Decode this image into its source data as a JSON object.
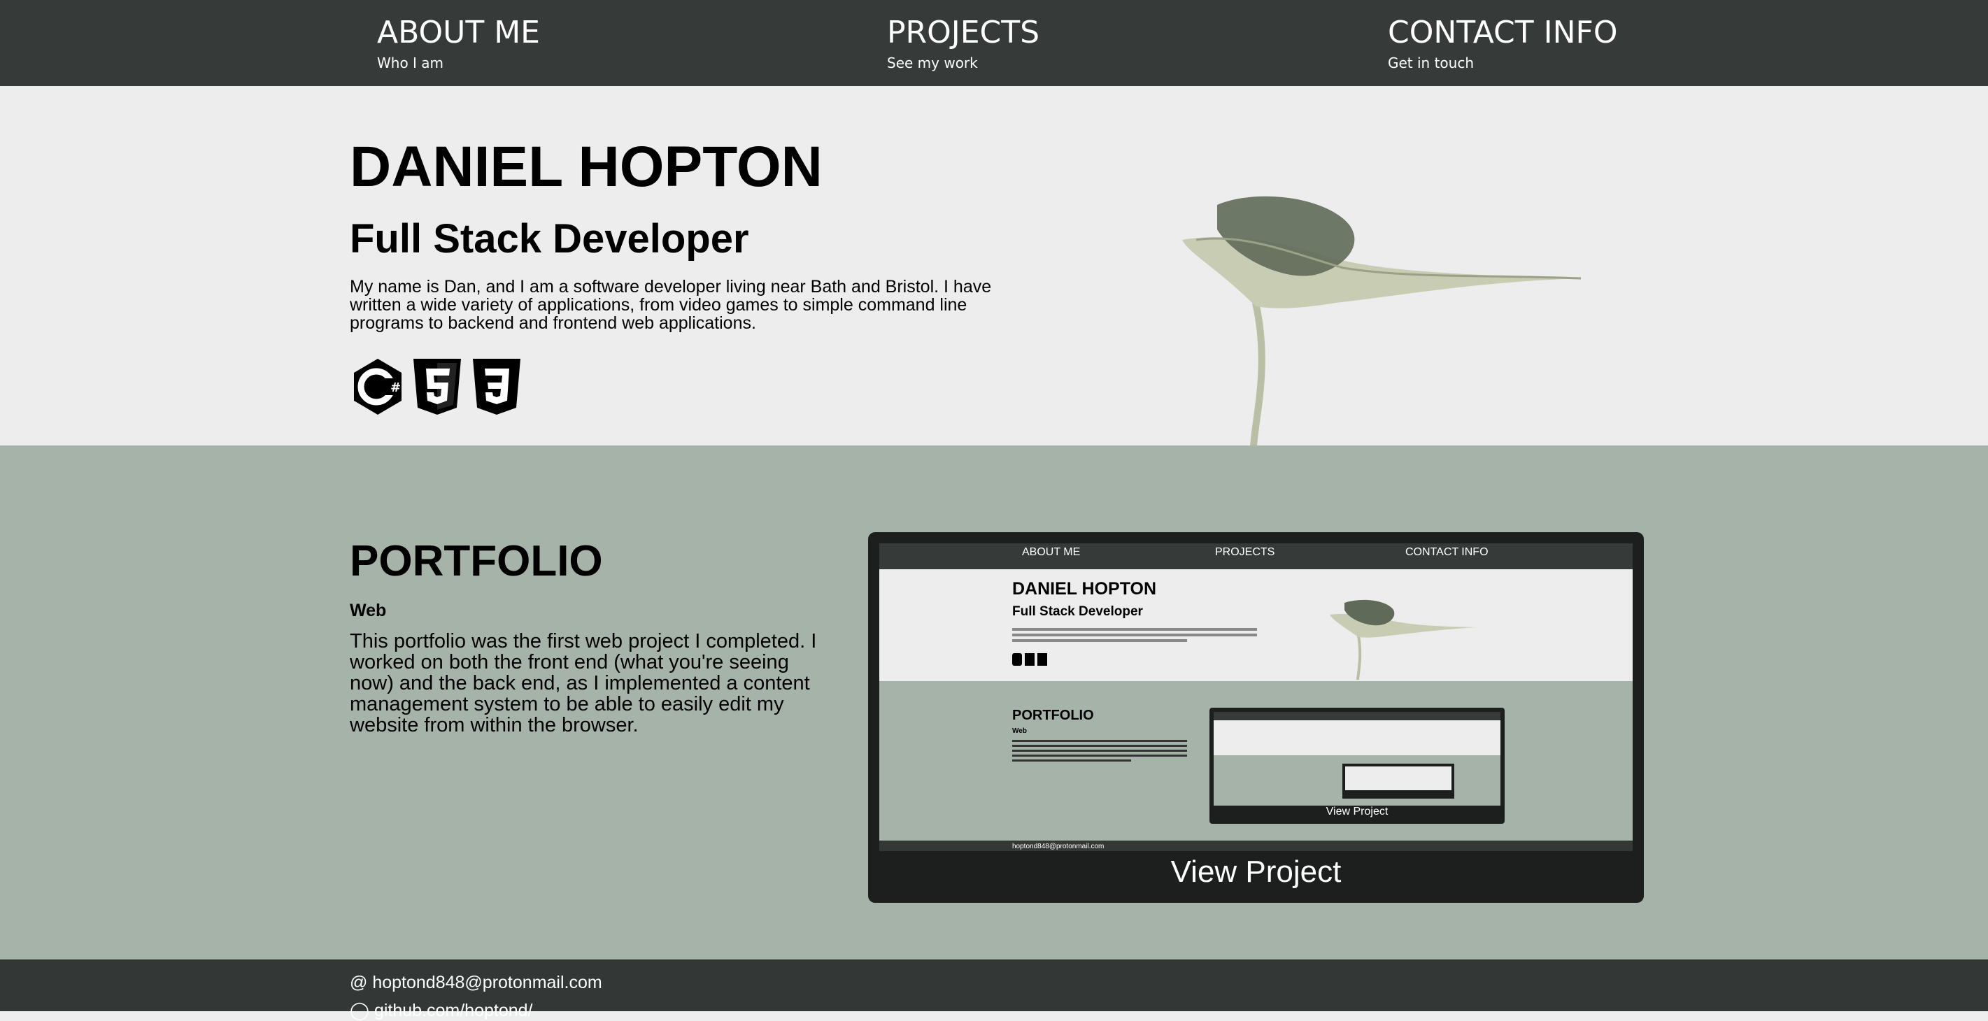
{
  "nav": {
    "items": [
      {
        "title": "ABOUT ME",
        "subtitle": "Who I am"
      },
      {
        "title": "PROJECTS",
        "subtitle": "See my work"
      },
      {
        "title": "CONTACT INFO",
        "subtitle": "Get in touch"
      }
    ]
  },
  "hero": {
    "name": "DANIEL HOPTON",
    "role": "Full Stack Developer",
    "bio": "My name is Dan, and I am a software developer living near Bath and Bristol. I have written a wide variety of applications, from video games to simple command line programs to backend and frontend web applications.",
    "tech_icons": [
      "csharp-icon",
      "html5-icon",
      "css3-icon"
    ]
  },
  "portfolio": {
    "heading": "PORTFOLIO",
    "project": {
      "category": "Web",
      "description": "This portfolio was the first web project I completed. I worked on both the front end (what you're seeing now) and the back end, as I implemented a content management system to be able to easily edit my website from within the browser.",
      "action_label": "View Project"
    }
  },
  "footer": {
    "email": "hoptond848@protonmail.com",
    "github": "github.com/hoptond/"
  },
  "colors": {
    "nav_bg": "#363b39",
    "hero_bg": "#ededed",
    "portfolio_bg": "#a5b3a8",
    "footer_bg": "#333735"
  }
}
